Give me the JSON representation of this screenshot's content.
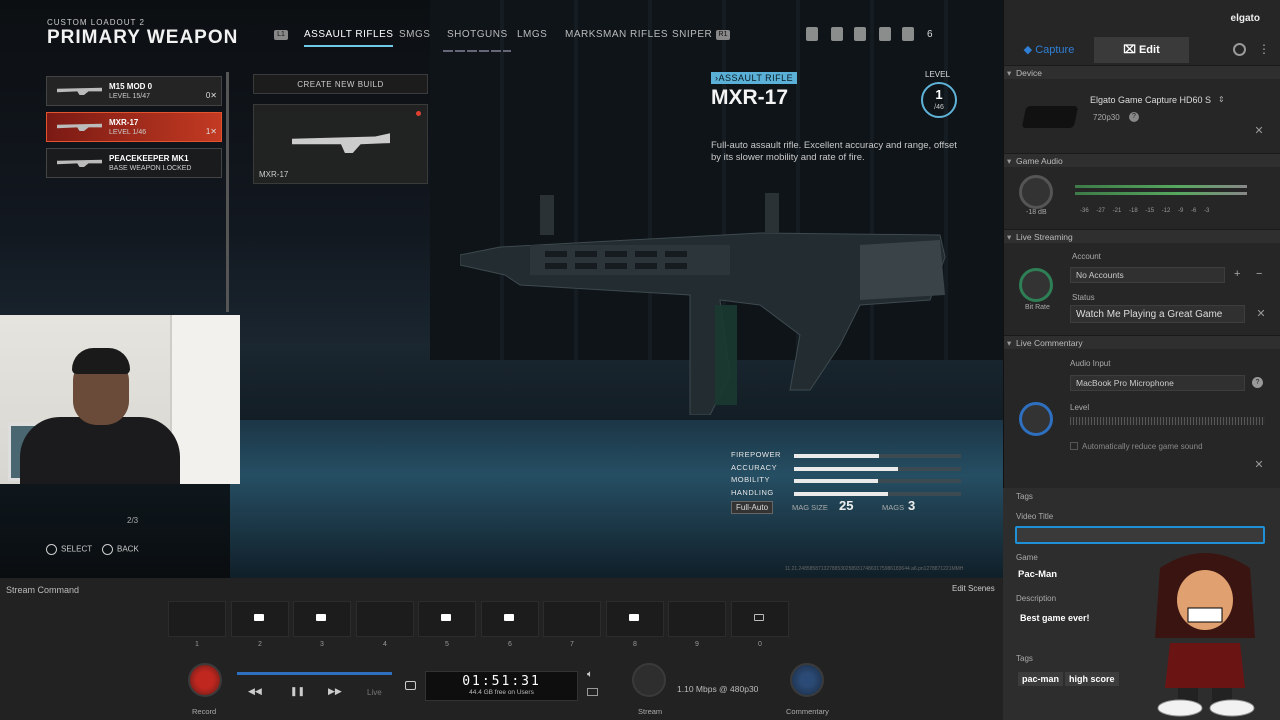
{
  "game": {
    "loadout_sub": "CUSTOM LOADOUT 2",
    "loadout_title": "PRIMARY WEAPON",
    "tabs": [
      {
        "label": "ASSAULT RIFLES",
        "active": true
      },
      {
        "label": "SMGS"
      },
      {
        "label": "SHOTGUNS"
      },
      {
        "label": "LMGS"
      },
      {
        "label": "MARKSMAN RIFLES"
      },
      {
        "label": "SNIPER"
      }
    ],
    "key_left": "L1",
    "key_right": "R1",
    "count_badge": "6",
    "weapons": [
      {
        "name": "M15 MOD 0",
        "level": "LEVEL 15/47",
        "mark": "0✕"
      },
      {
        "name": "MXR-17",
        "level": "LEVEL 1/46",
        "mark": "1✕",
        "selected": true
      },
      {
        "name": "PEACEKEEPER MK1",
        "level": "BASE WEAPON LOCKED",
        "locked": true
      }
    ],
    "create_build": "CREATE NEW BUILD",
    "build_name": "MXR-17",
    "weapon_type": "›ASSAULT RIFLE",
    "weapon_name": "MXR-17",
    "level_label": "LEVEL",
    "level_value": "1",
    "level_max": "/46",
    "description": "Full-auto assault rifle. Excellent accuracy and range, offset by its slower mobility and rate of fire.",
    "stats": [
      {
        "label": "FIREPOWER",
        "value": 0.51
      },
      {
        "label": "ACCURACY",
        "value": 0.62
      },
      {
        "label": "MOBILITY",
        "value": 0.5
      },
      {
        "label": "HANDLING",
        "value": 0.56
      }
    ],
    "fire_mode": "Full-Auto",
    "mag_size_label": "MAG SIZE",
    "mag_size": "25",
    "mags_label": "MAGS",
    "mags": "3",
    "page": "2/3",
    "hint_select": "SELECT",
    "hint_back": "BACK",
    "hash": "11.21.2485858713278853025893174863175986183644.a6.pn1278871221MMH"
  },
  "sidebar": {
    "brand": "elgato",
    "tab_capture": "Capture",
    "tab_edit": "Edit",
    "device_section": "Device",
    "device_name": "Elgato Game Capture HD60 S",
    "device_format": "720p30",
    "game_audio_section": "Game Audio",
    "game_audio_db": "-18 dB",
    "meter_scale": "-36 -27 -21 -18 -15 -12 -9 -6 -3",
    "live_streaming_section": "Live Streaming",
    "account_label": "Account",
    "account_value": "No Accounts",
    "bitrate_label": "Bit Rate",
    "status_label": "Status",
    "status_value": "Watch Me Playing a Great Game",
    "live_commentary_section": "Live Commentary",
    "audio_input_label": "Audio Input",
    "audio_input_value": "MacBook Pro Microphone",
    "level_label": "Level",
    "auto_reduce": "Automatically reduce game sound",
    "tags_section": "Tags",
    "video_title_label": "Video Title",
    "video_title_value": "",
    "game_label": "Game",
    "game_value": "Pac-Man",
    "description_label": "Description",
    "description_value": "Best game ever!",
    "tags_label": "Tags",
    "tags": [
      "pac-man",
      "high score"
    ]
  },
  "bottom": {
    "stream_command": "Stream Command",
    "edit_scenes": "Edit Scenes",
    "scenes": [
      "1",
      "2",
      "3",
      "4",
      "5",
      "6",
      "7",
      "8",
      "9",
      "0"
    ],
    "record_label": "Record",
    "live_label": "Live",
    "time": "01:51:31",
    "free_space": "44.4 GB free on Users",
    "stream_label": "Stream",
    "bitrate_status": "1.10 Mbps @ 480p30",
    "commentary_label": "Commentary"
  }
}
